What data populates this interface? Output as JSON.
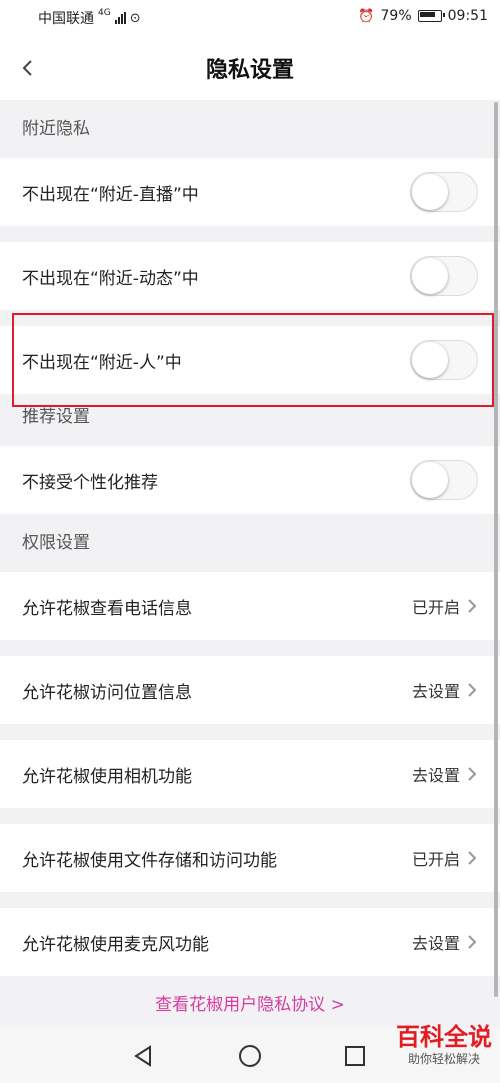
{
  "status_bar": {
    "carrier": "中国联通",
    "network": "4G",
    "battery": "79%",
    "time": "09:51"
  },
  "header": {
    "title": "隐私设置"
  },
  "sections": {
    "nearby": {
      "title": "附近隐私"
    },
    "recommend": {
      "title": "推荐设置"
    },
    "permissions": {
      "title": "权限设置"
    }
  },
  "rows": [
    {
      "label": "不出现在“附近-直播”中",
      "type": "toggle",
      "on": false
    },
    {
      "label": "不出现在“附近-动态”中",
      "type": "toggle",
      "on": false
    },
    {
      "label": "不出现在“附近-人”中",
      "type": "toggle",
      "on": false
    },
    {
      "label": "不接受个性化推荐",
      "type": "toggle",
      "on": false
    },
    {
      "label": "允许花椒查看电话信息",
      "value": "已开启"
    },
    {
      "label": "允许花椒访问位置信息",
      "value": "去设置"
    },
    {
      "label": "允许花椒使用相机功能",
      "value": "去设置"
    },
    {
      "label": "允许花椒使用文件存储和访问功能",
      "value": "已开启"
    },
    {
      "label": "允许花椒使用麦克风功能",
      "value": "去设置"
    }
  ],
  "footer": {
    "policy_link": "查看花椒用户隐私协议 >"
  },
  "watermark": {
    "main": "百科全说",
    "sub": "助你轻松解决"
  },
  "colors": {
    "highlight": "#e01b2f",
    "link": "#d63ca0",
    "watermark": "#e31b23"
  }
}
